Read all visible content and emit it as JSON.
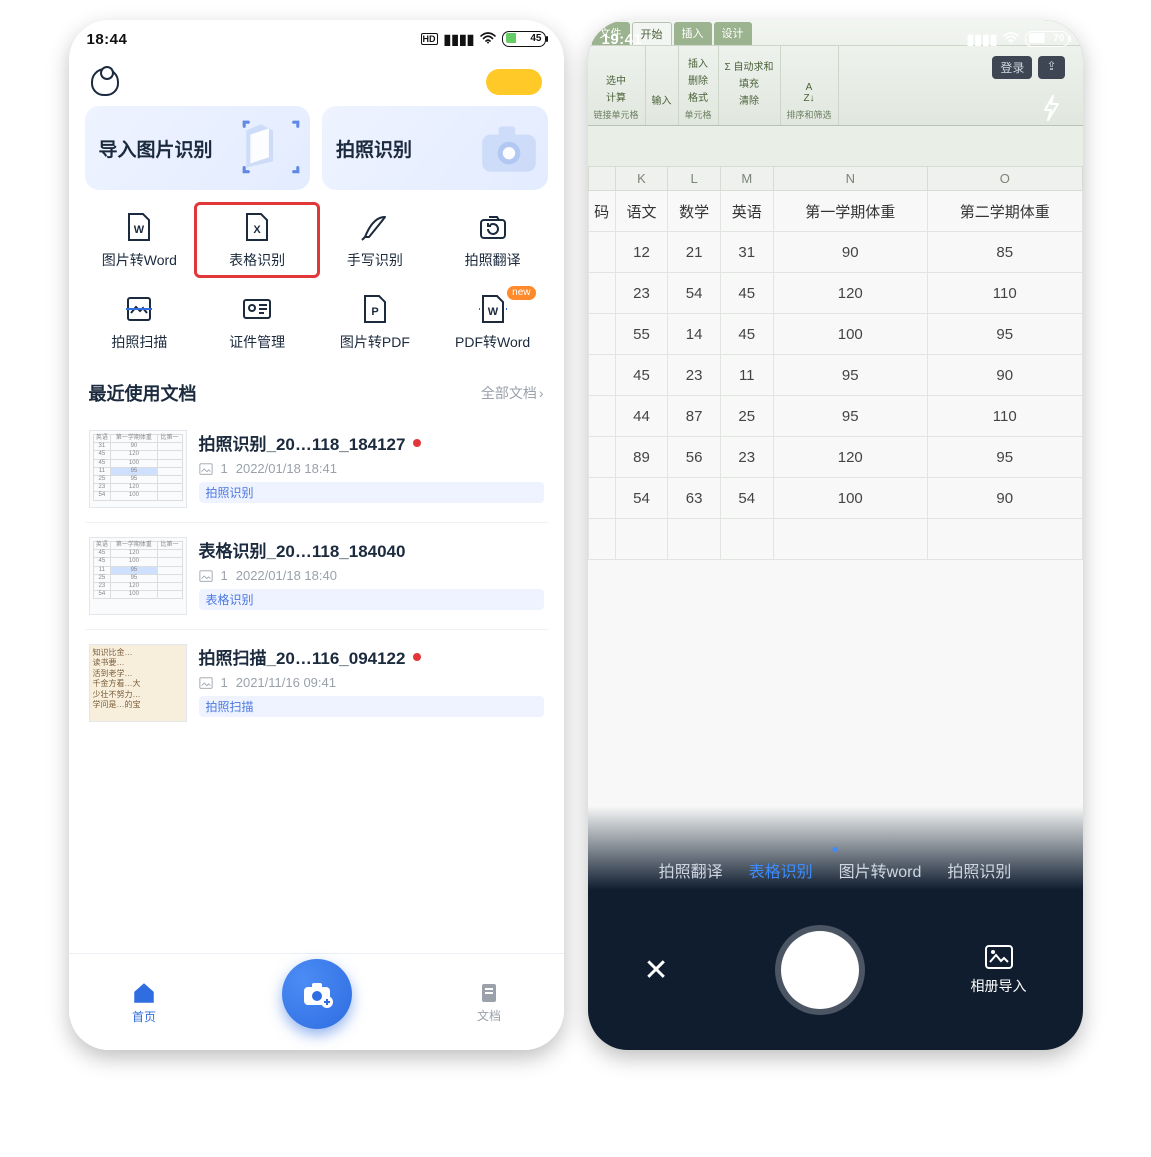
{
  "left": {
    "status_time": "18:44",
    "battery": "45",
    "hero": {
      "import_label": "导入图片识别",
      "photo_label": "拍照识别"
    },
    "grid": [
      {
        "label": "图片转Word"
      },
      {
        "label": "表格识别",
        "highlight": true
      },
      {
        "label": "手写识别"
      },
      {
        "label": "拍照翻译"
      },
      {
        "label": "拍照扫描"
      },
      {
        "label": "证件管理"
      },
      {
        "label": "图片转PDF"
      },
      {
        "label": "PDF转Word",
        "badge": "new"
      }
    ],
    "section_title": "最近使用文档",
    "section_more": "全部文档",
    "docs": [
      {
        "title": "拍照识别_20…118_184127",
        "dot": true,
        "count": "1",
        "date": "2022/01/18 18:41",
        "tag": "拍照识别"
      },
      {
        "title": "表格识别_20…118_184040",
        "dot": false,
        "count": "1",
        "date": "2022/01/18 18:40",
        "tag": "表格识别"
      },
      {
        "title": "拍照扫描_20…116_094122",
        "dot": true,
        "count": "1",
        "date": "2021/11/16 09:41",
        "tag": "拍照扫描"
      }
    ],
    "nav": {
      "home": "首页",
      "docs": "文档"
    }
  },
  "right": {
    "status_time": "19:41",
    "battery": "70",
    "btn_login": "登录",
    "ribbon_tabs": [
      "文件",
      "开始",
      "插入",
      "设计"
    ],
    "ribbon_groups": [
      "链接单元格",
      "单元格"
    ],
    "ribbon_extras": {
      "selected": "选中",
      "calc": "计算",
      "input": "输入",
      "insert": "插入",
      "delete": "删除",
      "format": "格式",
      "autosum": "Σ 自动求和",
      "fill": "填充",
      "clear": "清除",
      "sort": "排序和筛选"
    },
    "modes": [
      "拍照翻译",
      "表格识别",
      "图片转word",
      "拍照识别"
    ],
    "active_mode": "表格识别",
    "album_label": "相册导入"
  },
  "chart_data": {
    "type": "table",
    "title": "",
    "columns_letters": [
      "K",
      "L",
      "M",
      "N",
      "O"
    ],
    "columns": [
      "码",
      "语文",
      "数学",
      "英语",
      "第一学期体重",
      "第二学期体重"
    ],
    "rows": [
      [
        12,
        21,
        31,
        90,
        85
      ],
      [
        23,
        54,
        45,
        120,
        110
      ],
      [
        55,
        14,
        45,
        100,
        95
      ],
      [
        45,
        23,
        11,
        95,
        90
      ],
      [
        44,
        87,
        25,
        95,
        110
      ],
      [
        89,
        56,
        23,
        120,
        95
      ],
      [
        54,
        63,
        54,
        100,
        90
      ]
    ]
  }
}
